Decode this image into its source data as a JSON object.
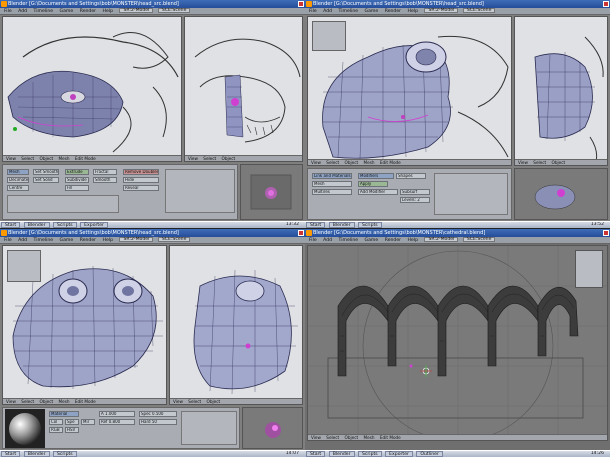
{
  "windows": [
    {
      "title": "Blender [G:\\Documents and Settings\\bob\\MONSTER\\head_src.blend]",
      "menu": [
        "File",
        "Add",
        "Timeline",
        "Game",
        "Render",
        "Help"
      ],
      "scene": "SCE:Scene",
      "view": "SR:2-Model",
      "vp_left_menu": [
        "View",
        "Select",
        "Object",
        "Mesh"
      ],
      "mode": "Edit Mode",
      "vp_right_menu": [
        "View",
        "Select",
        "Object"
      ],
      "buttons": [
        "Mesh",
        "Decimate",
        "Centre",
        "Set Smooth",
        "Set Solid",
        "Extrude",
        "Subdivide",
        "Fill",
        "Fractal",
        "Smooth",
        "Remove Doubles",
        "Hide",
        "Reveal"
      ],
      "taskbar": [
        "Start",
        "Blender",
        "Scripts",
        "Exporter"
      ],
      "clock": "13:32"
    },
    {
      "title": "Blender [G:\\Documents and Settings\\bob\\MONSTER\\head_src.blend]",
      "menu": [
        "File",
        "Add",
        "Timeline",
        "Game",
        "Render",
        "Help"
      ],
      "scene": "SCE:Scene",
      "view": "SR:2-Model",
      "vp_left_menu": [
        "View",
        "Select",
        "Object",
        "Mesh"
      ],
      "mode": "Edit Mode",
      "vp_right_menu": [
        "View",
        "Select",
        "Object"
      ],
      "buttons": [
        "Link and Materials",
        "Mesh",
        "Multires",
        "Modifiers",
        "Shapes",
        "Apply",
        "Add Modifier",
        "Subsurf",
        "Levels: 2"
      ],
      "taskbar": [
        "Start",
        "Blender",
        "Scripts"
      ],
      "clock": "13:52"
    },
    {
      "title": "Blender [G:\\Documents and Settings\\bob\\MONSTER\\head_src.blend]",
      "menu": [
        "File",
        "Add",
        "Timeline",
        "Game",
        "Render",
        "Help"
      ],
      "scene": "SCE:Scene",
      "view": "SR:2-Model",
      "vp_left_menu": [
        "View",
        "Select",
        "Object",
        "Mesh"
      ],
      "mode": "Edit Mode",
      "vp_right_menu": [
        "View",
        "Select",
        "Object"
      ],
      "buttons": [
        "Material",
        "Col",
        "Spe",
        "Mir",
        "RGB",
        "HSV",
        "A 1.000",
        "Ref 0.800",
        "Spec 0.500",
        "Hard 50"
      ],
      "taskbar": [
        "Start",
        "Blender",
        "Scripts"
      ],
      "clock": "14:07"
    },
    {
      "title": "Blender [G:\\Documents and Settings\\bob\\MONSTER\\cathedral.blend]",
      "menu": [
        "File",
        "Add",
        "Timeline",
        "Game",
        "Render",
        "Help"
      ],
      "scene": "SCE:Scene",
      "view": "SR:2-Model",
      "vp_left_menu": [
        "View",
        "Select",
        "Object",
        "Mesh"
      ],
      "mode": "Edit Mode",
      "vp_right_menu": [
        "View",
        "Select",
        "Object"
      ],
      "buttons": [],
      "taskbar": [
        "Start",
        "Blender",
        "Scripts",
        "Exporter",
        "Outliner"
      ],
      "clock": "14:26"
    }
  ],
  "colors": {
    "title_bar": "#2d58a8",
    "mesh": "#8f93b8",
    "selection": "#d040d0",
    "grid_bg": "#7a7a7a"
  }
}
